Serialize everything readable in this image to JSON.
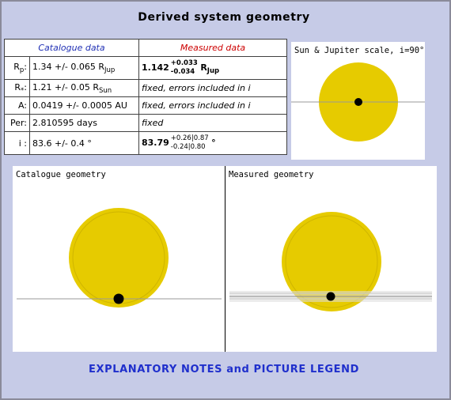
{
  "title": "Derived system geometry",
  "table": {
    "header_catalogue": "Catalogue data",
    "header_measured": "Measured data",
    "rows": {
      "rp": {
        "param_main": "R",
        "param_sub": "p",
        "param_suffix": ":",
        "cat_value": "1.34 +/- 0.065 R",
        "cat_unit_sub": "Jup",
        "meas_value": "1.142",
        "meas_err_plus": "+0.033",
        "meas_err_minus": "-0.034",
        "meas_unit": "R",
        "meas_unit_sub": "Jup"
      },
      "rstar": {
        "param_main": "R",
        "param_sub": "*",
        "param_suffix": ":",
        "cat_value": "1.21 +/- 0.05 R",
        "cat_unit_sub": "Sun",
        "meas_text": "fixed, errors included in i"
      },
      "a": {
        "param": "A:",
        "cat_value": "0.0419 +/- 0.0005 AU",
        "meas_text": "fixed, errors included in i"
      },
      "per": {
        "param": "Per:",
        "cat_value": "2.810595 days",
        "meas_text": "fixed"
      },
      "i": {
        "param": "i :",
        "cat_value": "83.6 +/- 0.4 °",
        "meas_value": "83.79",
        "meas_err_plus": "+0.26|0.87",
        "meas_err_minus": "-0.24|0.80",
        "meas_unit": "°"
      }
    }
  },
  "panels": {
    "sun_scale": {
      "caption": "Sun & Jupiter scale, i=90°"
    },
    "catalogue": {
      "caption": "Catalogue geometry"
    },
    "measured": {
      "caption": "Measured geometry"
    }
  },
  "notes_link": "EXPLANATORY NOTES and PICTURE LEGEND",
  "colors": {
    "frame_bg": "#c6cbe7",
    "star_fill": "#e6cb00",
    "star_ring": "#cfb500",
    "planet": "#000000",
    "orbit_line": "#999999",
    "header_catalogue": "#1f2fb4",
    "header_measured": "#cc0000",
    "link": "#1f2fcc"
  }
}
